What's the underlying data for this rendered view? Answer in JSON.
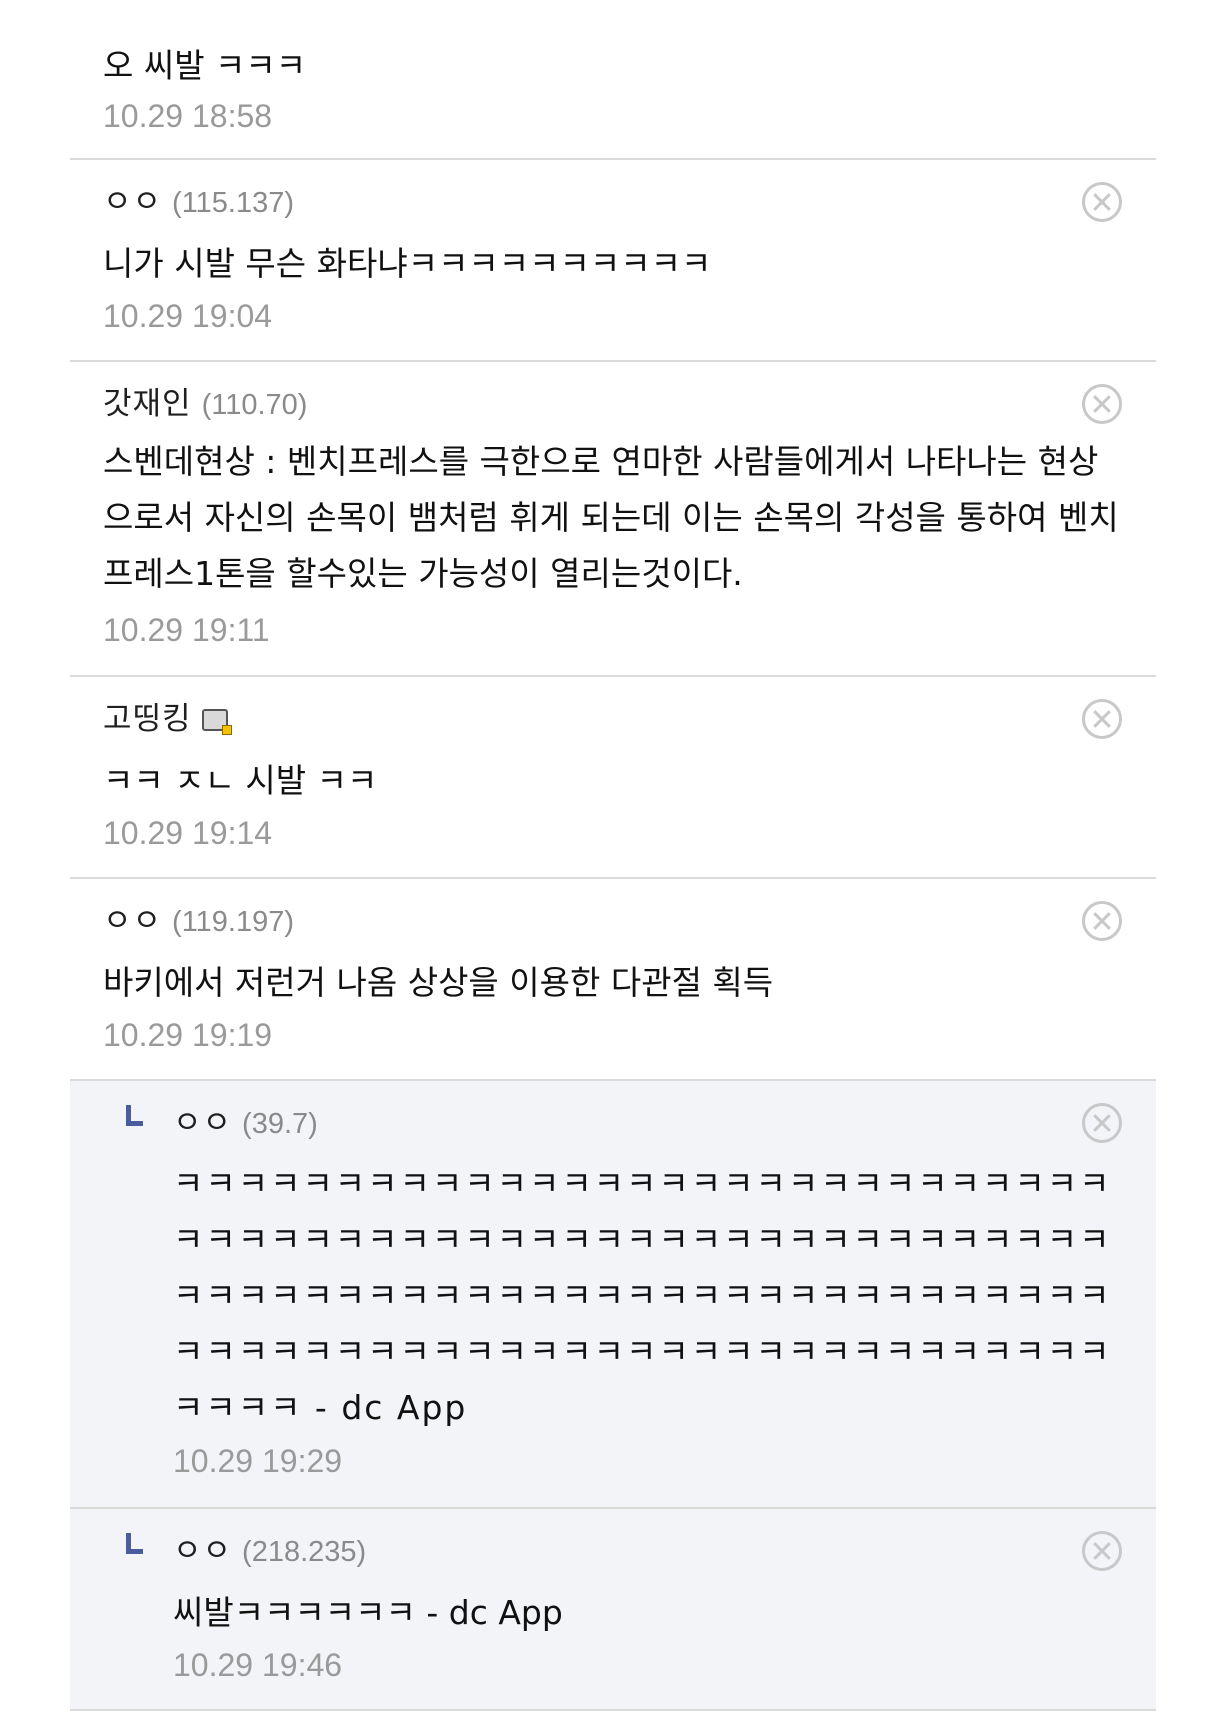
{
  "comments": [
    {
      "body": "오 씨발 ㅋㅋㅋ",
      "time": "10.29 18:58"
    },
    {
      "nick": "ㅇㅇ",
      "ip": "(115.137)",
      "body": "니가 시발 무슨 화타냐ㅋㅋㅋㅋㅋㅋㅋㅋㅋㅋ",
      "time": "10.29 19:04"
    },
    {
      "nick": "갓재인",
      "ip": "(110.70)",
      "body": "스벤데현상 : 벤치프레스를 극한으로 연마한 사람들에게서 나타나는 현상으로서 자신의 손목이 뱀처럼 휘게 되는데 이는 손목의 각성을 통하여 벤치프레스1톤을 할수있는 가능성이 열리는것이다.",
      "time": "10.29 19:11"
    },
    {
      "nick": "고띵킹",
      "body": "ㅋㅋ ㅈㄴ 시발 ㅋㅋ",
      "time": "10.29 19:14"
    },
    {
      "nick": "ㅇㅇ",
      "ip": "(119.197)",
      "body": "바키에서 저런거 나옴 상상을 이용한 다관절 획득",
      "time": "10.29 19:19"
    },
    {
      "nick": "ㅇㅇ",
      "ip": "(39.7)",
      "body": "ㅋㅋㅋㅋㅋㅋㅋㅋㅋㅋㅋㅋㅋㅋㅋㅋㅋㅋㅋㅋㅋㅋㅋㅋㅋㅋㅋㅋㅋㅋㅋㅋㅋㅋㅋㅋㅋㅋㅋㅋㅋㅋㅋㅋㅋㅋㅋㅋㅋㅋㅋㅋㅋㅋㅋㅋㅋㅋㅋㅋㅋㅋㅋㅋㅋㅋㅋㅋㅋㅋㅋㅋㅋㅋㅋㅋㅋㅋㅋㅋㅋㅋㅋㅋㅋㅋㅋㅋㅋㅋㅋㅋㅋㅋㅋㅋㅋㅋㅋㅋㅋㅋㅋㅋㅋㅋㅋㅋㅋㅋㅋㅋㅋㅋㅋㅋㅋㅋㅋㅋ - dc App",
      "time": "10.29 19:29"
    },
    {
      "nick": "ㅇㅇ",
      "ip": "(218.235)",
      "body": "씨발ㅋㅋㅋㅋㅋㅋ - dc App",
      "time": "10.29 19:46"
    }
  ]
}
